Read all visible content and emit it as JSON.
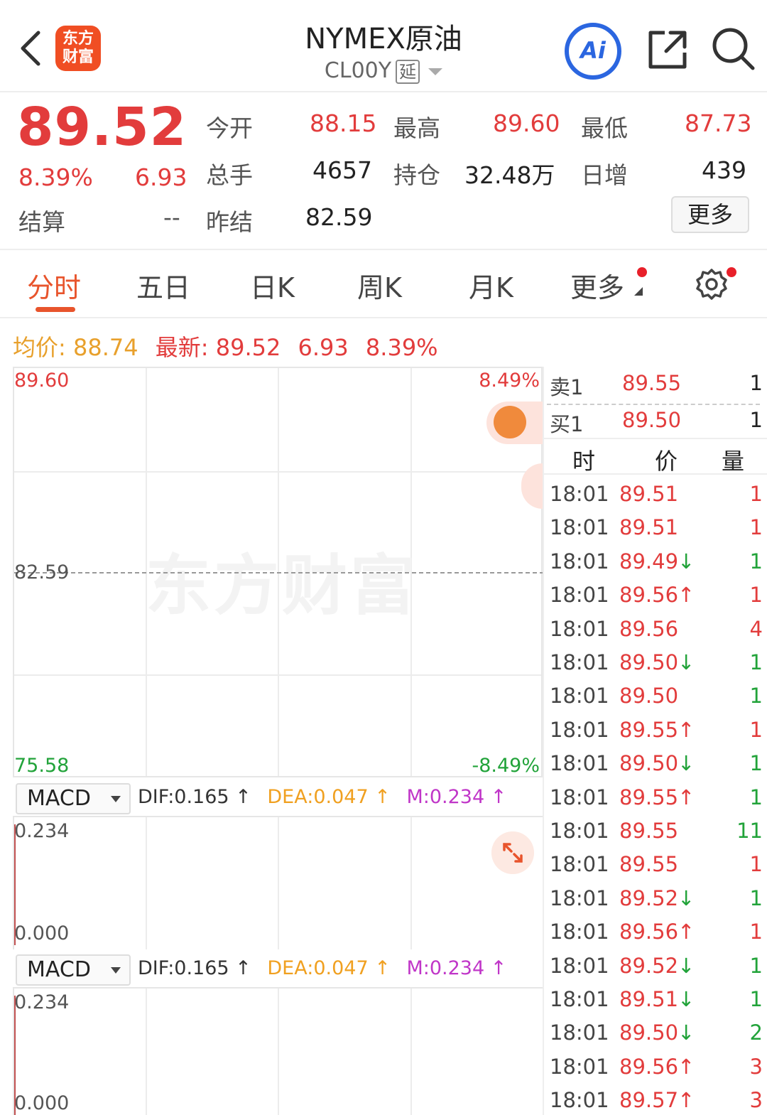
{
  "header": {
    "logo_line1": "东方",
    "logo_line2": "财富",
    "title": "NYMEX原油",
    "code": "CL00Y",
    "delay_badge": "延",
    "ai_label": "Ai"
  },
  "quote": {
    "price": "89.52",
    "change_pct": "8.39%",
    "change": "6.93",
    "settle_label": "结算",
    "settle_value": "--",
    "fields": [
      {
        "label": "今开",
        "value": "88.15"
      },
      {
        "label": "最高",
        "value": "89.60"
      },
      {
        "label": "最低",
        "value": "87.73"
      },
      {
        "label": "总手",
        "value": "4657"
      },
      {
        "label": "持仓",
        "value": "32.48万"
      },
      {
        "label": "日增",
        "value": "439"
      },
      {
        "label": "昨结",
        "value": "82.59"
      }
    ],
    "more_label": "更多"
  },
  "tabs": [
    "分时",
    "五日",
    "日K",
    "周K",
    "月K",
    "更多"
  ],
  "info_line": {
    "avg_label": "均价:",
    "avg_value": "88.74",
    "latest_label": "最新:",
    "latest_value": "89.52",
    "change": "6.93",
    "change_pct": "8.39%"
  },
  "chart": {
    "y_max": "89.60",
    "y_mid": "82.59",
    "y_min": "75.58",
    "pct_max": "8.49%",
    "pct_min": "-8.49%",
    "watermark": "东方财富"
  },
  "macd": [
    {
      "name": "MACD",
      "dif": "DIF:0.165 ↑",
      "dea": "DEA:0.047 ↑",
      "m": "M:0.234 ↑",
      "y_top": "0.234",
      "y_bottom": "0.000"
    },
    {
      "name": "MACD",
      "dif": "DIF:0.165 ↑",
      "dea": "DEA:0.047 ↑",
      "m": "M:0.234 ↑",
      "y_top": "0.234",
      "y_bottom": "0.000"
    }
  ],
  "order_book": {
    "ask": {
      "label": "卖1",
      "price": "89.55",
      "qty": "1"
    },
    "bid": {
      "label": "买1",
      "price": "89.50",
      "qty": "1"
    }
  },
  "trades_header": {
    "time": "时",
    "price": "价",
    "qty": "量"
  },
  "trades": [
    {
      "time": "18:01",
      "price": "89.51",
      "arrow": "",
      "qty": "1",
      "dir": "buy"
    },
    {
      "time": "18:01",
      "price": "89.51",
      "arrow": "",
      "qty": "1",
      "dir": "buy"
    },
    {
      "time": "18:01",
      "price": "89.49",
      "arrow": "↓",
      "qty": "1",
      "dir": "sell"
    },
    {
      "time": "18:01",
      "price": "89.56",
      "arrow": "↑",
      "qty": "1",
      "dir": "buy"
    },
    {
      "time": "18:01",
      "price": "89.56",
      "arrow": "",
      "qty": "4",
      "dir": "buy"
    },
    {
      "time": "18:01",
      "price": "89.50",
      "arrow": "↓",
      "qty": "1",
      "dir": "sell"
    },
    {
      "time": "18:01",
      "price": "89.50",
      "arrow": "",
      "qty": "1",
      "dir": "sell"
    },
    {
      "time": "18:01",
      "price": "89.55",
      "arrow": "↑",
      "qty": "1",
      "dir": "buy"
    },
    {
      "time": "18:01",
      "price": "89.50",
      "arrow": "↓",
      "qty": "1",
      "dir": "sell"
    },
    {
      "time": "18:01",
      "price": "89.55",
      "arrow": "↑",
      "qty": "1",
      "dir": "sell"
    },
    {
      "time": "18:01",
      "price": "89.55",
      "arrow": "",
      "qty": "11",
      "dir": "sell"
    },
    {
      "time": "18:01",
      "price": "89.55",
      "arrow": "",
      "qty": "1",
      "dir": "buy"
    },
    {
      "time": "18:01",
      "price": "89.52",
      "arrow": "↓",
      "qty": "1",
      "dir": "sell"
    },
    {
      "time": "18:01",
      "price": "89.56",
      "arrow": "↑",
      "qty": "1",
      "dir": "buy"
    },
    {
      "time": "18:01",
      "price": "89.52",
      "arrow": "↓",
      "qty": "1",
      "dir": "sell"
    },
    {
      "time": "18:01",
      "price": "89.51",
      "arrow": "↓",
      "qty": "1",
      "dir": "sell"
    },
    {
      "time": "18:01",
      "price": "89.50",
      "arrow": "↓",
      "qty": "2",
      "dir": "sell"
    },
    {
      "time": "18:01",
      "price": "89.56",
      "arrow": "↑",
      "qty": "3",
      "dir": "buy"
    },
    {
      "time": "18:01",
      "price": "89.57",
      "arrow": "↑",
      "qty": "3",
      "dir": "buy"
    }
  ],
  "colors": {
    "up": "#e23c3c",
    "down": "#22a33a",
    "accent": "#e8542c",
    "ai": "#2b66e0",
    "avg": "#e8a02c",
    "dea": "#f0a020",
    "m": "#c036c8"
  }
}
